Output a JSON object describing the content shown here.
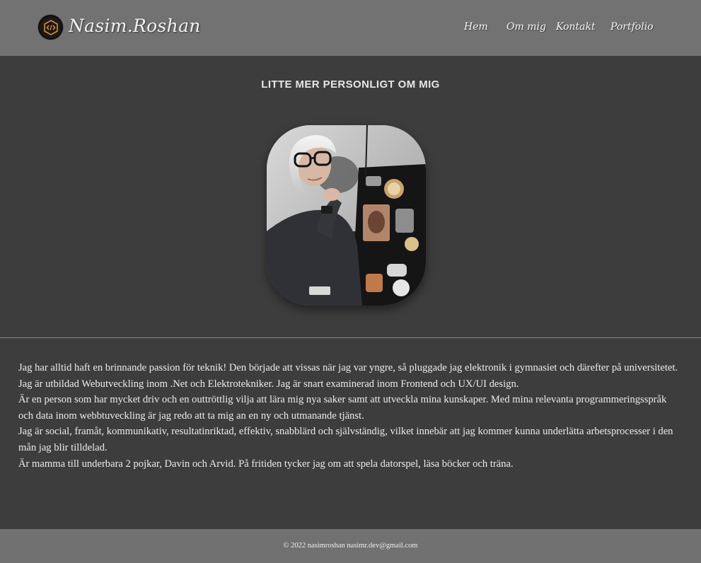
{
  "header": {
    "brand": "Nasim.Roshan",
    "logo_icon": "code-brackets-icon",
    "nav": [
      {
        "label": "Hem"
      },
      {
        "label": "Om mig"
      },
      {
        "label": "Kontakt"
      },
      {
        "label": "Portfolio"
      }
    ]
  },
  "main": {
    "title": "LITTE MER PERSONLIGT OM MIG",
    "bio": [
      "Jag har alltid haft en brinnande passion för teknik! Den började att vissas när jag var yngre, så pluggade jag elektronik i gymnasiet och därefter på universitetet.",
      "Jag är utbildad Webutveckling inom .Net och Elektrotekniker. Jag är snart examinerad inom Frontend och UX/UI design.",
      "Är en person som har mycket driv och en outtröttlig vilja att lära mig nya saker samt att utveckla mina kunskaper. Med mina relevanta programmeringsspråk och data inom webbtuveckling är jag redo att ta mig an en ny och utmanande tjänst.",
      "Jag är social, framåt, kommunikativ, resultatinriktad, effektiv, snabblärd och självständig, vilket innebär att jag kommer kunna underlätta arbetsprocesser i den mån jag blir tilldelad.",
      "Är mamma till underbara 2 pojkar, Davin och Arvid. På fritiden tycker jag om att spela datorspel, läsa böcker och träna."
    ]
  },
  "footer": {
    "text": "© 2022 nasimroshan nasimr.dev@gmail.com"
  },
  "colors": {
    "header_bg": "#727272",
    "page_bg": "#3d3d3d",
    "footer_bg": "#717171",
    "logo_accent": "#e08a2c"
  }
}
